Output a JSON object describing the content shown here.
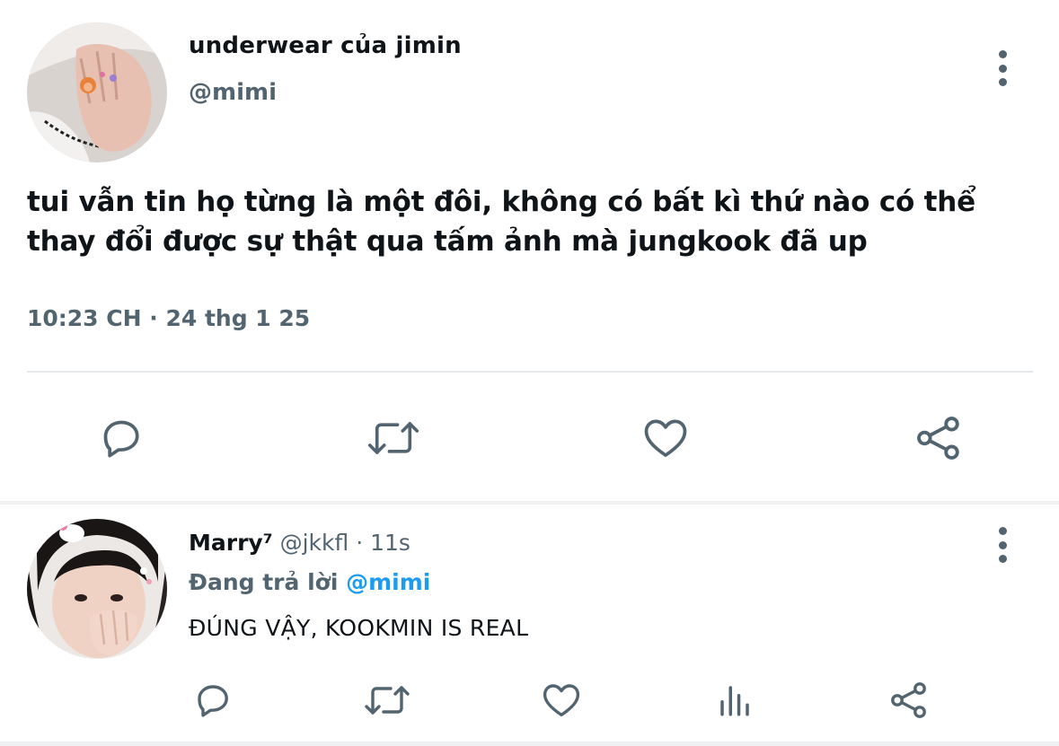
{
  "tweet": {
    "display_name": "underwear của jimin",
    "handle": "@mimi",
    "text": "tui vẫn tin họ từng là một đôi, không có bất kì thứ nào có thể thay đổi được sự thật qua tấm ảnh mà jungkook đã up",
    "timestamp": "10:23 CH · 24 thg 1 25",
    "actions": [
      "reply-icon",
      "retweet-icon",
      "like-icon",
      "share-icon"
    ]
  },
  "reply": {
    "display_name": "Marry⁷",
    "handle": "@jkkfl",
    "separator": "·",
    "age": "11s",
    "replying_to_label": "Đang trả lời",
    "replying_to_handle": "@mimi",
    "text": "ĐÚNG VẬY, KOOKMIN IS REAL",
    "actions": [
      "reply-icon",
      "retweet-icon",
      "like-icon",
      "views-icon",
      "share-icon"
    ]
  },
  "colors": {
    "text_primary": "#0f1419",
    "text_secondary": "#536471",
    "accent": "#1d9bf0",
    "divider": "#e6e9eb"
  }
}
